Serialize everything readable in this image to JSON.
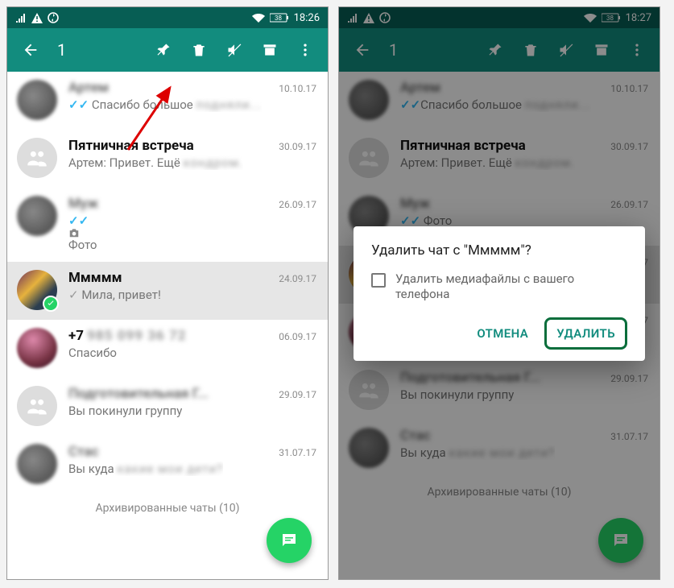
{
  "statusbar": {
    "time_left": "18:26",
    "time_right": "18:27",
    "battery": "38"
  },
  "toolbar": {
    "selected_count": "1"
  },
  "chats": [
    {
      "name": "Артем",
      "name_blurred": true,
      "date": "10.10.17",
      "msg_prefix_ticks": true,
      "msg": "Спасибо большое",
      "msg_blur_tail": "подняли...",
      "bold": false,
      "selected": false,
      "avatar": "blur"
    },
    {
      "name": "Пятничная встреча",
      "date": "30.09.17",
      "msg": "Артем: Привет. Ещё",
      "msg_blur_tail": "кондром.",
      "bold": true,
      "selected": false,
      "avatar": "group"
    },
    {
      "name": "Муж",
      "name_blurred": true,
      "date": "26.09.17",
      "msg_prefix_ticks": true,
      "msg_camera": true,
      "msg": "Фото",
      "bold": false,
      "selected": false,
      "avatar": "blur"
    },
    {
      "name": "Ммммм",
      "date": "24.09.17",
      "msg_gray_check": true,
      "msg": "Мила, привет!",
      "bold": true,
      "selected": true,
      "avatar": "flower"
    },
    {
      "name": "+7",
      "name_blur_tail": "985 099 36 72",
      "date": "06.09.17",
      "msg": "Спасибо",
      "bold": true,
      "selected": false,
      "avatar": "photo2"
    },
    {
      "name_blurred": true,
      "name": "Подготовительная Г...",
      "date": "29.09.17",
      "msg": "Вы покинули группу",
      "bold": false,
      "selected": false,
      "avatar": "group"
    },
    {
      "name": "Стас",
      "name_blurred": true,
      "date": "31.07.17",
      "msg": "Вы куда",
      "msg_blur_tail": "какие мои дети?",
      "bold": false,
      "selected": false,
      "avatar": "blur"
    }
  ],
  "archived_label": "Архивированные чаты (10)",
  "dialog": {
    "title": "Удалить чат с \"Ммммм\"?",
    "checkbox_label": "Удалить медиафайлы с вашего телефона",
    "cancel": "ОТМЕНА",
    "confirm": "УДАЛИТЬ"
  }
}
